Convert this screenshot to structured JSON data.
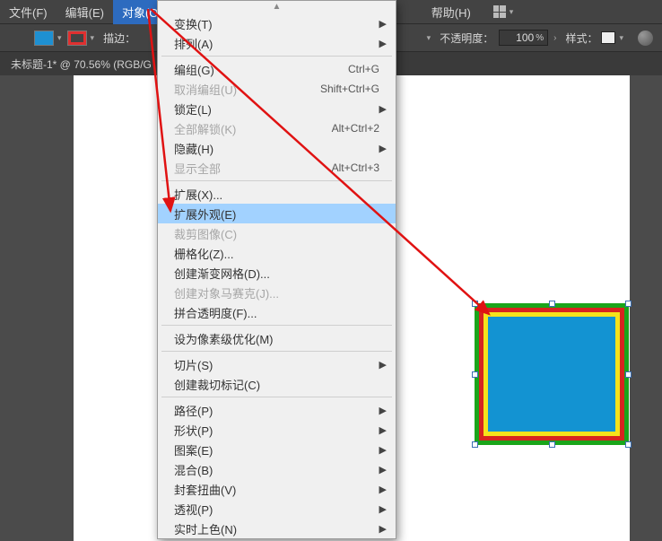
{
  "menubar": {
    "file": "文件(F)",
    "edit": "编辑(E)",
    "object": "对象(O)",
    "help": "帮助(H)"
  },
  "toolbar": {
    "stroke_label": "描边：",
    "opacity_label": "不透明度：",
    "opacity_value": "100",
    "style_label": "样式："
  },
  "doc_tab": "未标题-1* @ 70.56% (RGB/G",
  "dropdown": {
    "transform": "变换(T)",
    "arrange": "排列(A)",
    "group": "编组(G)",
    "group_sc": "Ctrl+G",
    "ungroup": "取消编组(U)",
    "ungroup_sc": "Shift+Ctrl+G",
    "lock": "锁定(L)",
    "unlock_all": "全部解锁(K)",
    "unlock_all_sc": "Alt+Ctrl+2",
    "hide": "隐藏(H)",
    "show_all": "显示全部",
    "show_all_sc": "Alt+Ctrl+3",
    "expand": "扩展(X)...",
    "expand_appearance": "扩展外观(E)",
    "crop_image": "裁剪图像(C)",
    "rasterize": "栅格化(Z)...",
    "gradient_mesh": "创建渐变网格(D)...",
    "mosaic": "创建对象马赛克(J)...",
    "flatten": "拼合透明度(F)...",
    "pixel_perfect": "设为像素级优化(M)",
    "slice": "切片(S)",
    "trim_marks": "创建裁切标记(C)",
    "path": "路径(P)",
    "shape": "形状(P)",
    "pattern": "图案(E)",
    "blend": "混合(B)",
    "envelope": "封套扭曲(V)",
    "perspective": "透视(P)",
    "live_paint": "实时上色(N)"
  }
}
